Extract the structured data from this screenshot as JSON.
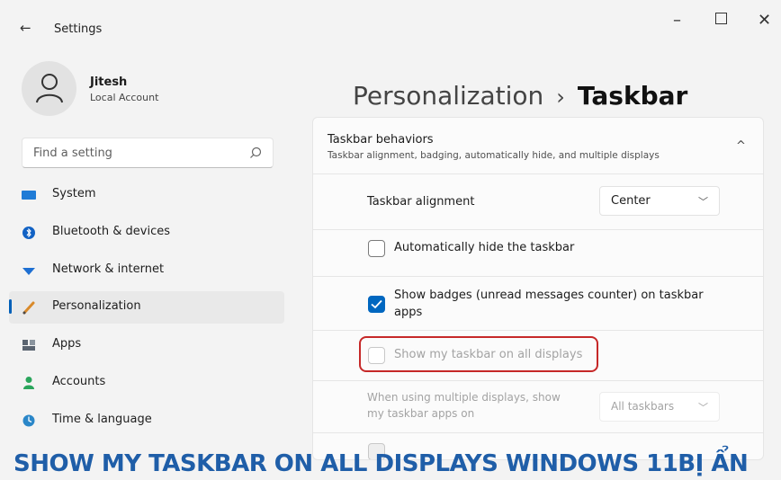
{
  "window": {
    "title": "Settings",
    "back_glyph": "←",
    "minimize_glyph": "–",
    "close_glyph": "✕"
  },
  "profile": {
    "name": "Jitesh",
    "account_type": "Local Account"
  },
  "search": {
    "placeholder": "Find a setting"
  },
  "nav": {
    "items": [
      {
        "label": "System",
        "icon": "system-icon",
        "color": "#1f7bd6"
      },
      {
        "label": "Bluetooth & devices",
        "icon": "bluetooth-icon",
        "color": "#1262c4"
      },
      {
        "label": "Network & internet",
        "icon": "network-icon",
        "color": "#1e6fd2"
      },
      {
        "label": "Personalization",
        "icon": "personalization-icon",
        "color": "#d98a2b",
        "active": true
      },
      {
        "label": "Apps",
        "icon": "apps-icon",
        "color": "#5a6470"
      },
      {
        "label": "Accounts",
        "icon": "accounts-icon",
        "color": "#2aa55c"
      },
      {
        "label": "Time & language",
        "icon": "time-language-icon",
        "color": "#2a86c8"
      }
    ]
  },
  "breadcrumb": {
    "parent": "Personalization",
    "separator": "›",
    "current": "Taskbar"
  },
  "group": {
    "title": "Taskbar behaviors",
    "description": "Taskbar alignment, badging, automatically hide, and multiple displays",
    "chevron": "^",
    "alignment": {
      "label": "Taskbar alignment",
      "value": "Center"
    },
    "auto_hide": {
      "label": "Automatically hide the taskbar",
      "checked": false
    },
    "badges": {
      "label_line1": "Show badges (unread messages counter) on taskbar",
      "label_line2": "apps",
      "checked": true
    },
    "all_displays": {
      "label": "Show my taskbar on all displays",
      "checked": false,
      "enabled": false
    },
    "multi_display": {
      "label_line1": "When using multiple displays, show",
      "label_line2": "my taskbar apps on",
      "value": "All taskbars"
    }
  },
  "banner": {
    "text": "SHOW MY TASKBAR ON ALL DISPLAYS WINDOWS 11BỊ ẨN",
    "color": "#1f5ea8"
  },
  "accent_color": "#0067c0",
  "highlight_color": "#c62828"
}
